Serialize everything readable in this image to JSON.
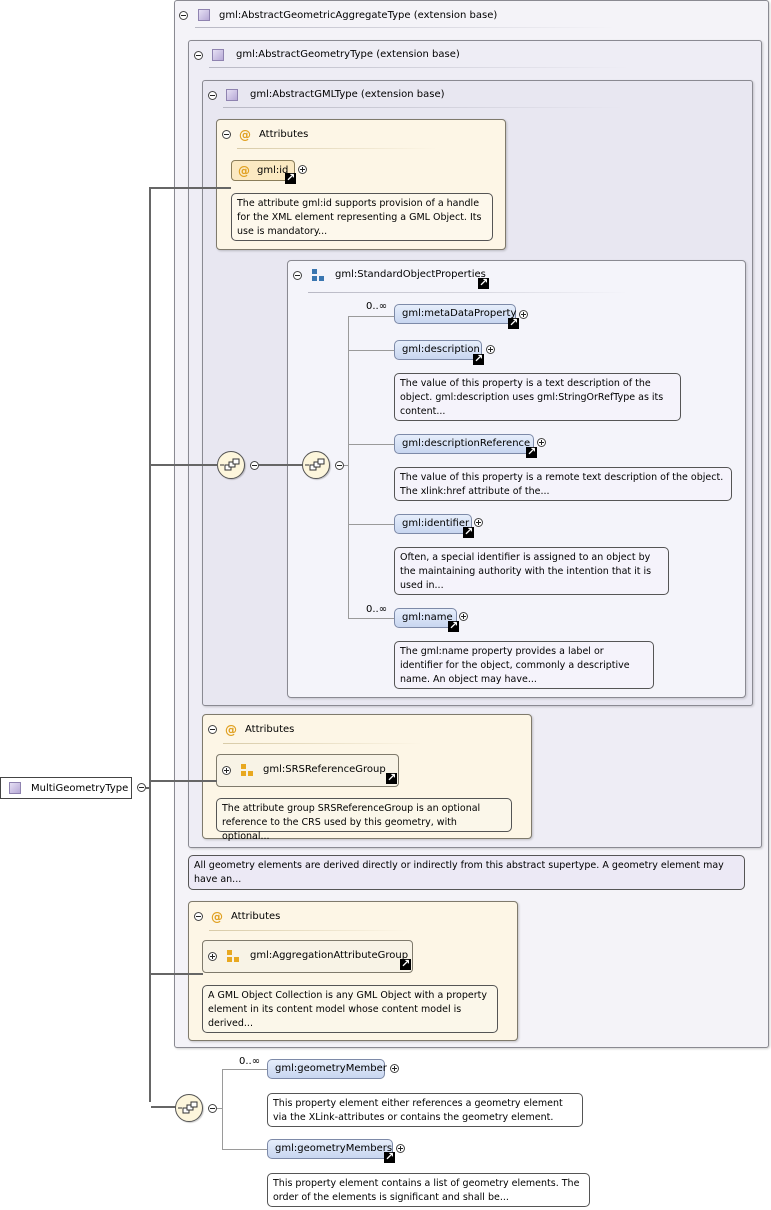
{
  "root": {
    "label": "MultiGeometryType"
  },
  "ext1": {
    "label": "gml:AbstractGeometricAggregateType (extension base)"
  },
  "ext2": {
    "label": "gml:AbstractGeometryType (extension base)"
  },
  "ext3": {
    "label": "gml:AbstractGMLType (extension base)"
  },
  "attrs_gml": {
    "title": "Attributes",
    "item": "gml:id",
    "doc": "The attribute gml:id supports provision of a handle for the XML element representing a GML Object. Its use is mandatory..."
  },
  "std_props": {
    "label": "gml:StandardObjectProperties",
    "elements": [
      {
        "name": "gml:metaDataProperty",
        "card": "0..∞",
        "doc": ""
      },
      {
        "name": "gml:description",
        "card": "",
        "doc": "The value of this property is a text description of the object. gml:description uses gml:StringOrRefType as its content..."
      },
      {
        "name": "gml:descriptionReference",
        "card": "",
        "doc": "The value of this property is a remote text description of the object. The xlink:href attribute of the..."
      },
      {
        "name": "gml:identifier",
        "card": "",
        "doc": "Often, a special identifier is assigned to an object by the maintaining authority with the intention that it is used in..."
      },
      {
        "name": "gml:name",
        "card": "0..∞",
        "doc": "The gml:name property provides a label or identifier for the object, commonly a descriptive name. An object may have..."
      }
    ]
  },
  "attrs_srs": {
    "title": "Attributes",
    "item": "gml:SRSReferenceGroup",
    "doc": "The attribute group SRSReferenceGroup is an optional reference to the CRS used by this geometry, with optional..."
  },
  "ext2_doc": "All geometry elements are derived directly or indirectly from this abstract supertype. A geometry element may have an...",
  "attrs_agg": {
    "title": "Attributes",
    "item": "gml:AggregationAttributeGroup",
    "doc": "A GML Object Collection is any GML Object with a property element in its content model whose content model is derived..."
  },
  "members": [
    {
      "name": "gml:geometryMember",
      "card": "0..∞",
      "doc": "This property element either references a geometry element via the XLink-attributes or contains the geometry element."
    },
    {
      "name": "gml:geometryMembers",
      "card": "",
      "doc": "This property element contains a list of geometry elements. The order of the elements is significant and shall be..."
    }
  ]
}
